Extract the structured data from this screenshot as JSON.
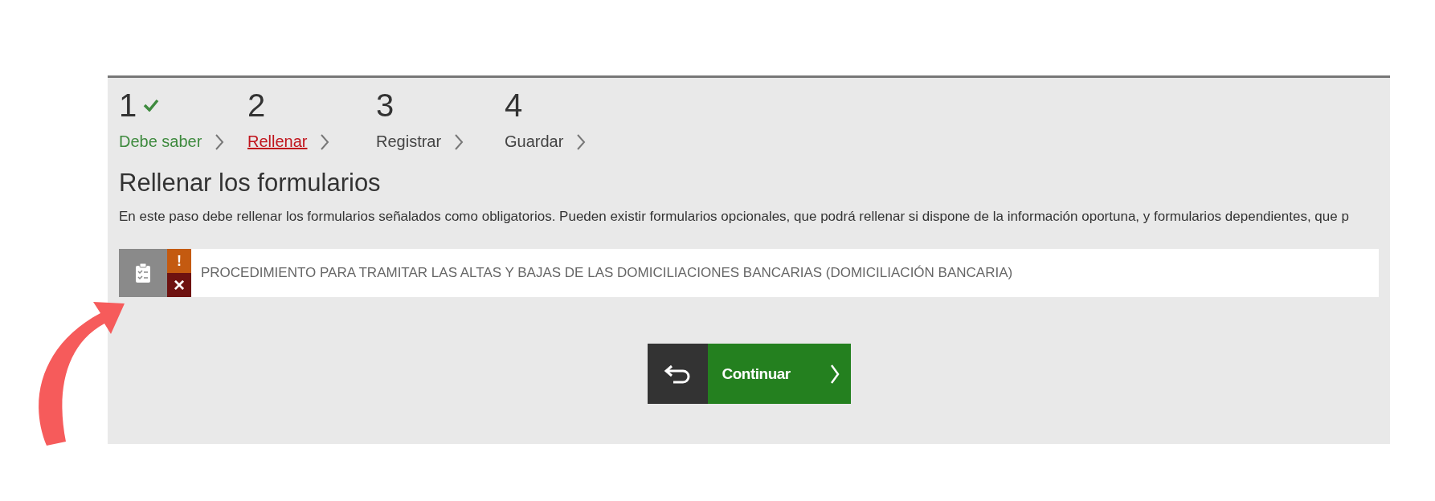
{
  "steps": [
    {
      "number": "1",
      "label": "Debe saber",
      "completed": true,
      "selected": false
    },
    {
      "number": "2",
      "label": "Rellenar",
      "completed": false,
      "selected": true
    },
    {
      "number": "3",
      "label": "Registrar",
      "completed": false,
      "selected": false
    },
    {
      "number": "4",
      "label": "Guardar",
      "completed": false,
      "selected": false
    }
  ],
  "heading": "Rellenar los formularios",
  "description": "En este paso debe rellenar los formularios señalados como obligatorios. Pueden existir formularios opcionales, que podrá rellenar si dispone de la información oportuna, y formularios dependientes, que p",
  "forms": [
    {
      "title": "PROCEDIMIENTO PARA TRAMITAR LAS ALTAS Y BAJAS DE LAS DOMICILIACIONES BANCARIAS (DOMICILIACIÓN BANCARIA)",
      "warning": "!",
      "status": "×"
    }
  ],
  "actions": {
    "continue": "Continuar"
  }
}
